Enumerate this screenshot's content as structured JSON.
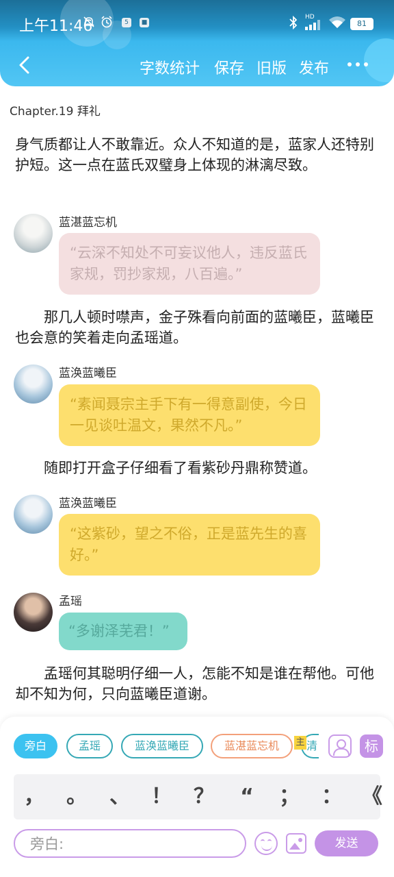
{
  "status_bar": {
    "time": "上午11:46",
    "mute_icon": "bell-off-icon",
    "alarm_icon": "alarm-icon",
    "notif_a": "5",
    "notif_b": "■",
    "bluetooth_icon": "bluetooth-icon",
    "network_label": "HD",
    "wifi_icon": "wifi-icon",
    "battery": "81"
  },
  "header": {
    "back_icon": "chevron-left-icon",
    "actions": [
      "字数统计",
      "保存",
      "旧版",
      "发布"
    ],
    "more_icon": "more-horizontal-icon"
  },
  "chapter_title": "Chapter.19 拜礼",
  "content": {
    "para1": "身气质都让人不敢靠近。众人不知道的是，蓝家人还特别护短。这一点在蓝氏双璧身上体现的淋漓尽致。",
    "msg1": {
      "speaker": "蓝湛蓝忘机",
      "text": "“云深不知处不可妄议他人，违反蓝氏家规，罚抄家规，八百遍。”"
    },
    "para2": "　　那几人顿时噤声，金子殊看向前面的蓝曦臣，蓝曦臣也会意的笑着走向孟瑶道。",
    "msg2": {
      "speaker": "蓝涣蓝曦臣",
      "text": "“素闻聂宗主手下有一得意副使，今日一见谈吐温文，果然不凡。”"
    },
    "para3": "　　随即打开盒子仔细看了看紫砂丹鼎称赞道。",
    "msg3": {
      "speaker": "蓝涣蓝曦臣",
      "text": "“这紫砂，望之不俗，正是蓝先生的喜好。”"
    },
    "msg4": {
      "speaker": "孟瑶",
      "text": "“多谢泽芜君！”"
    },
    "para4": "　　孟瑶何其聪明仔细一人，怎能不知是谁在帮他。可他却不知为何，只向蓝曦臣道谢。"
  },
  "composer": {
    "roles": [
      "旁白",
      "孟瑶",
      "蓝涣蓝曦臣",
      "蓝湛蓝忘机",
      "清"
    ],
    "main_tag": "主",
    "role_manage_icon": "user-square-icon",
    "mark_label": "标",
    "punctuation": [
      "，",
      "。",
      "、",
      "！",
      "？",
      "“",
      "；",
      "：",
      "《"
    ],
    "input_placeholder": "旁白:",
    "emoji_icon": "emoji-icon",
    "image_icon": "image-icon",
    "send_label": "发送"
  },
  "colors": {
    "header_blue": "#3bb8ee",
    "accent_purple": "#c493e6",
    "bubble_pink": "#f4dfe0",
    "bubble_yellow": "#fddf6e",
    "bubble_teal": "#82d9cb"
  }
}
